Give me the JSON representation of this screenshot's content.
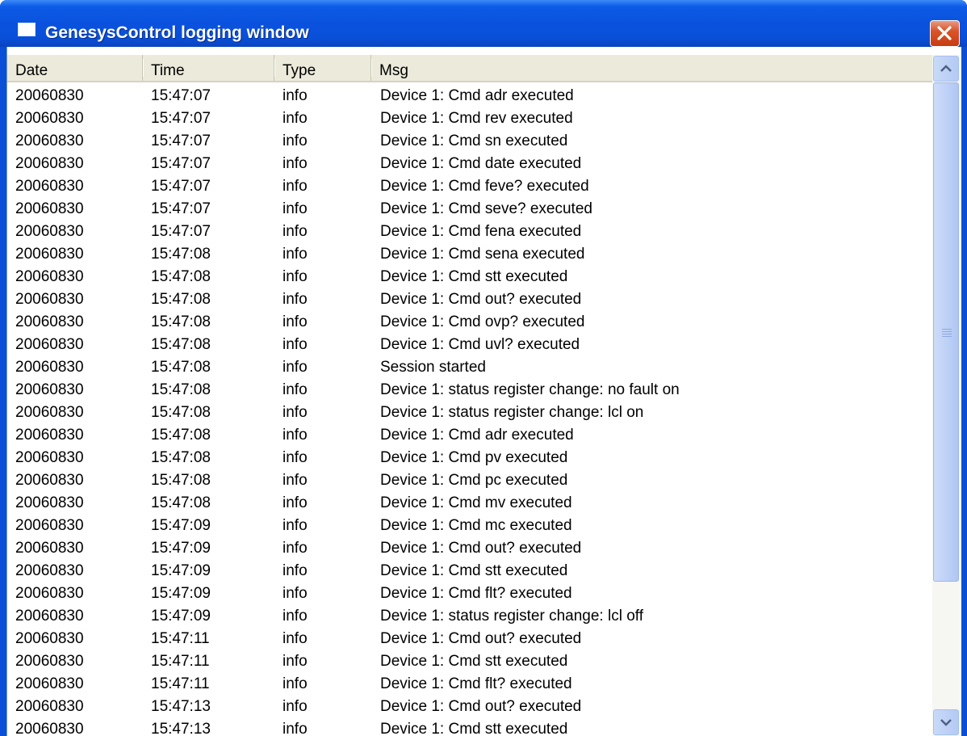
{
  "window": {
    "title": "GenesysControl logging window"
  },
  "table": {
    "columns": [
      {
        "label": "Date"
      },
      {
        "label": "Time"
      },
      {
        "label": "Type"
      },
      {
        "label": "Msg"
      }
    ],
    "rows": [
      {
        "date": "20060830",
        "time": "15:47:07",
        "type": "info",
        "msg": "Device 1: Cmd adr executed"
      },
      {
        "date": "20060830",
        "time": "15:47:07",
        "type": "info",
        "msg": "Device 1: Cmd rev executed"
      },
      {
        "date": "20060830",
        "time": "15:47:07",
        "type": "info",
        "msg": "Device 1: Cmd sn executed"
      },
      {
        "date": "20060830",
        "time": "15:47:07",
        "type": "info",
        "msg": "Device 1: Cmd date executed"
      },
      {
        "date": "20060830",
        "time": "15:47:07",
        "type": "info",
        "msg": "Device 1: Cmd feve? executed"
      },
      {
        "date": "20060830",
        "time": "15:47:07",
        "type": "info",
        "msg": "Device 1: Cmd seve? executed"
      },
      {
        "date": "20060830",
        "time": "15:47:07",
        "type": "info",
        "msg": "Device 1: Cmd fena executed"
      },
      {
        "date": "20060830",
        "time": "15:47:08",
        "type": "info",
        "msg": "Device 1: Cmd sena executed"
      },
      {
        "date": "20060830",
        "time": "15:47:08",
        "type": "info",
        "msg": "Device 1: Cmd stt executed"
      },
      {
        "date": "20060830",
        "time": "15:47:08",
        "type": "info",
        "msg": "Device 1: Cmd out? executed"
      },
      {
        "date": "20060830",
        "time": "15:47:08",
        "type": "info",
        "msg": "Device 1: Cmd ovp? executed"
      },
      {
        "date": "20060830",
        "time": "15:47:08",
        "type": "info",
        "msg": "Device 1: Cmd uvl? executed"
      },
      {
        "date": "20060830",
        "time": "15:47:08",
        "type": "info",
        "msg": "Session started"
      },
      {
        "date": "20060830",
        "time": "15:47:08",
        "type": "info",
        "msg": "Device 1: status register change: no fault on"
      },
      {
        "date": "20060830",
        "time": "15:47:08",
        "type": "info",
        "msg": "Device 1: status register change: lcl on"
      },
      {
        "date": "20060830",
        "time": "15:47:08",
        "type": "info",
        "msg": "Device 1: Cmd adr executed"
      },
      {
        "date": "20060830",
        "time": "15:47:08",
        "type": "info",
        "msg": "Device 1: Cmd pv executed"
      },
      {
        "date": "20060830",
        "time": "15:47:08",
        "type": "info",
        "msg": "Device 1: Cmd pc executed"
      },
      {
        "date": "20060830",
        "time": "15:47:08",
        "type": "info",
        "msg": "Device 1: Cmd mv executed"
      },
      {
        "date": "20060830",
        "time": "15:47:09",
        "type": "info",
        "msg": "Device 1: Cmd mc executed"
      },
      {
        "date": "20060830",
        "time": "15:47:09",
        "type": "info",
        "msg": "Device 1: Cmd out? executed"
      },
      {
        "date": "20060830",
        "time": "15:47:09",
        "type": "info",
        "msg": "Device 1: Cmd stt executed"
      },
      {
        "date": "20060830",
        "time": "15:47:09",
        "type": "info",
        "msg": "Device 1: Cmd flt? executed"
      },
      {
        "date": "20060830",
        "time": "15:47:09",
        "type": "info",
        "msg": "Device 1: status register change: lcl off"
      },
      {
        "date": "20060830",
        "time": "15:47:11",
        "type": "info",
        "msg": "Device 1: Cmd out? executed"
      },
      {
        "date": "20060830",
        "time": "15:47:11",
        "type": "info",
        "msg": "Device 1: Cmd stt executed"
      },
      {
        "date": "20060830",
        "time": "15:47:11",
        "type": "info",
        "msg": "Device 1: Cmd flt? executed"
      },
      {
        "date": "20060830",
        "time": "15:47:13",
        "type": "info",
        "msg": "Device 1: Cmd out? executed"
      },
      {
        "date": "20060830",
        "time": "15:47:13",
        "type": "info",
        "msg": "Device 1: Cmd stt executed"
      }
    ]
  },
  "icons": {
    "window_icon": "window-icon",
    "close": "close-icon",
    "scroll_up": "up-arrow-icon",
    "scroll_down": "down-arrow-icon",
    "thumb_grip": "grip-icon"
  },
  "colors": {
    "titlebar": "#0a52de",
    "close_button": "#d9542a",
    "header_bg": "#ebeadb",
    "scrollbar_thumb": "#bccff6"
  }
}
